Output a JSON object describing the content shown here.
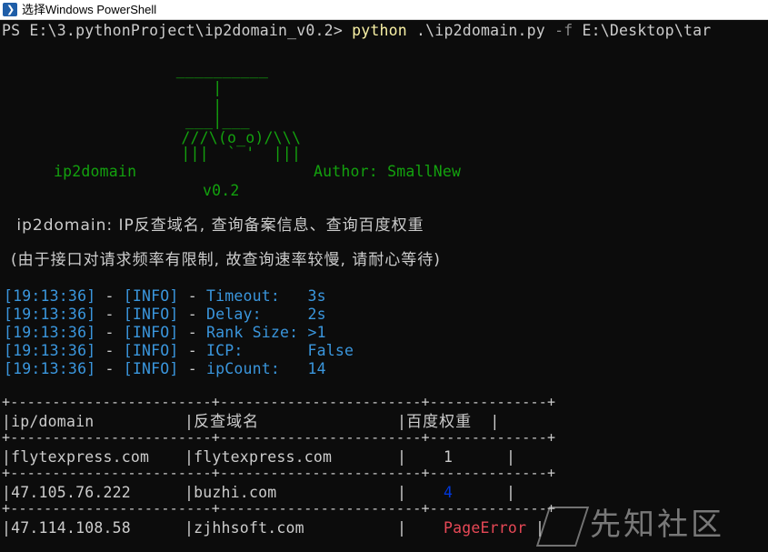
{
  "window": {
    "title": "选择Windows PowerShell",
    "icon": "powershell-icon"
  },
  "prompt": {
    "ps_path": "PS E:\\3.pythonProject\\ip2domain_v0.2>",
    "command": "python",
    "args": " .\\ip2domain.py ",
    "flag": "-f",
    "target": " E:\\Desktop\\tar"
  },
  "banner": {
    "art": [
      "             __________",
      "                 |",
      "                 |",
      "              ___|___",
      "          ///\\(o_o)/\\\\\\",
      "          |||  ` '  |||"
    ],
    "name": "ip2domain",
    "author": "Author: SmallNew",
    "version": "v0.2"
  },
  "description": " ip2domain: IP反查域名, 查询备案信息、查询百度权重",
  "notice": "(由于接口对请求频率有限制, 故查询速率较慢, 请耐心等待)",
  "logs": [
    {
      "time": "[19:13:36]",
      "sep": " - ",
      "level": "[INFO]",
      "sep2": " - ",
      "message": "Timeout:   3s"
    },
    {
      "time": "[19:13:36]",
      "sep": " - ",
      "level": "[INFO]",
      "sep2": " - ",
      "message": "Delay:     2s"
    },
    {
      "time": "[19:13:36]",
      "sep": " - ",
      "level": "[INFO]",
      "sep2": " - ",
      "message": "Rank Size: >1"
    },
    {
      "time": "[19:13:36]",
      "sep": " - ",
      "level": "[INFO]",
      "sep2": " - ",
      "message": "ICP:       False"
    },
    {
      "time": "[19:13:36]",
      "sep": " - ",
      "level": "[INFO]",
      "sep2": " - ",
      "message": "ipCount:   14"
    }
  ],
  "table": {
    "border": "+------------------------+------------------------+--------------+",
    "headers": [
      "ip/domain",
      "反查域名",
      "百度权重"
    ],
    "rows": [
      {
        "ip": "flytexpress.com",
        "domain": "flytexpress.com",
        "rank": "1"
      },
      {
        "ip": "47.105.76.222",
        "domain": "buzhi.com",
        "rank": "4"
      },
      {
        "ip": "47.114.108.58",
        "domain": "zjhhsoft.com",
        "rank": "PageError"
      }
    ]
  },
  "watermark": {
    "text": "先知社区"
  }
}
